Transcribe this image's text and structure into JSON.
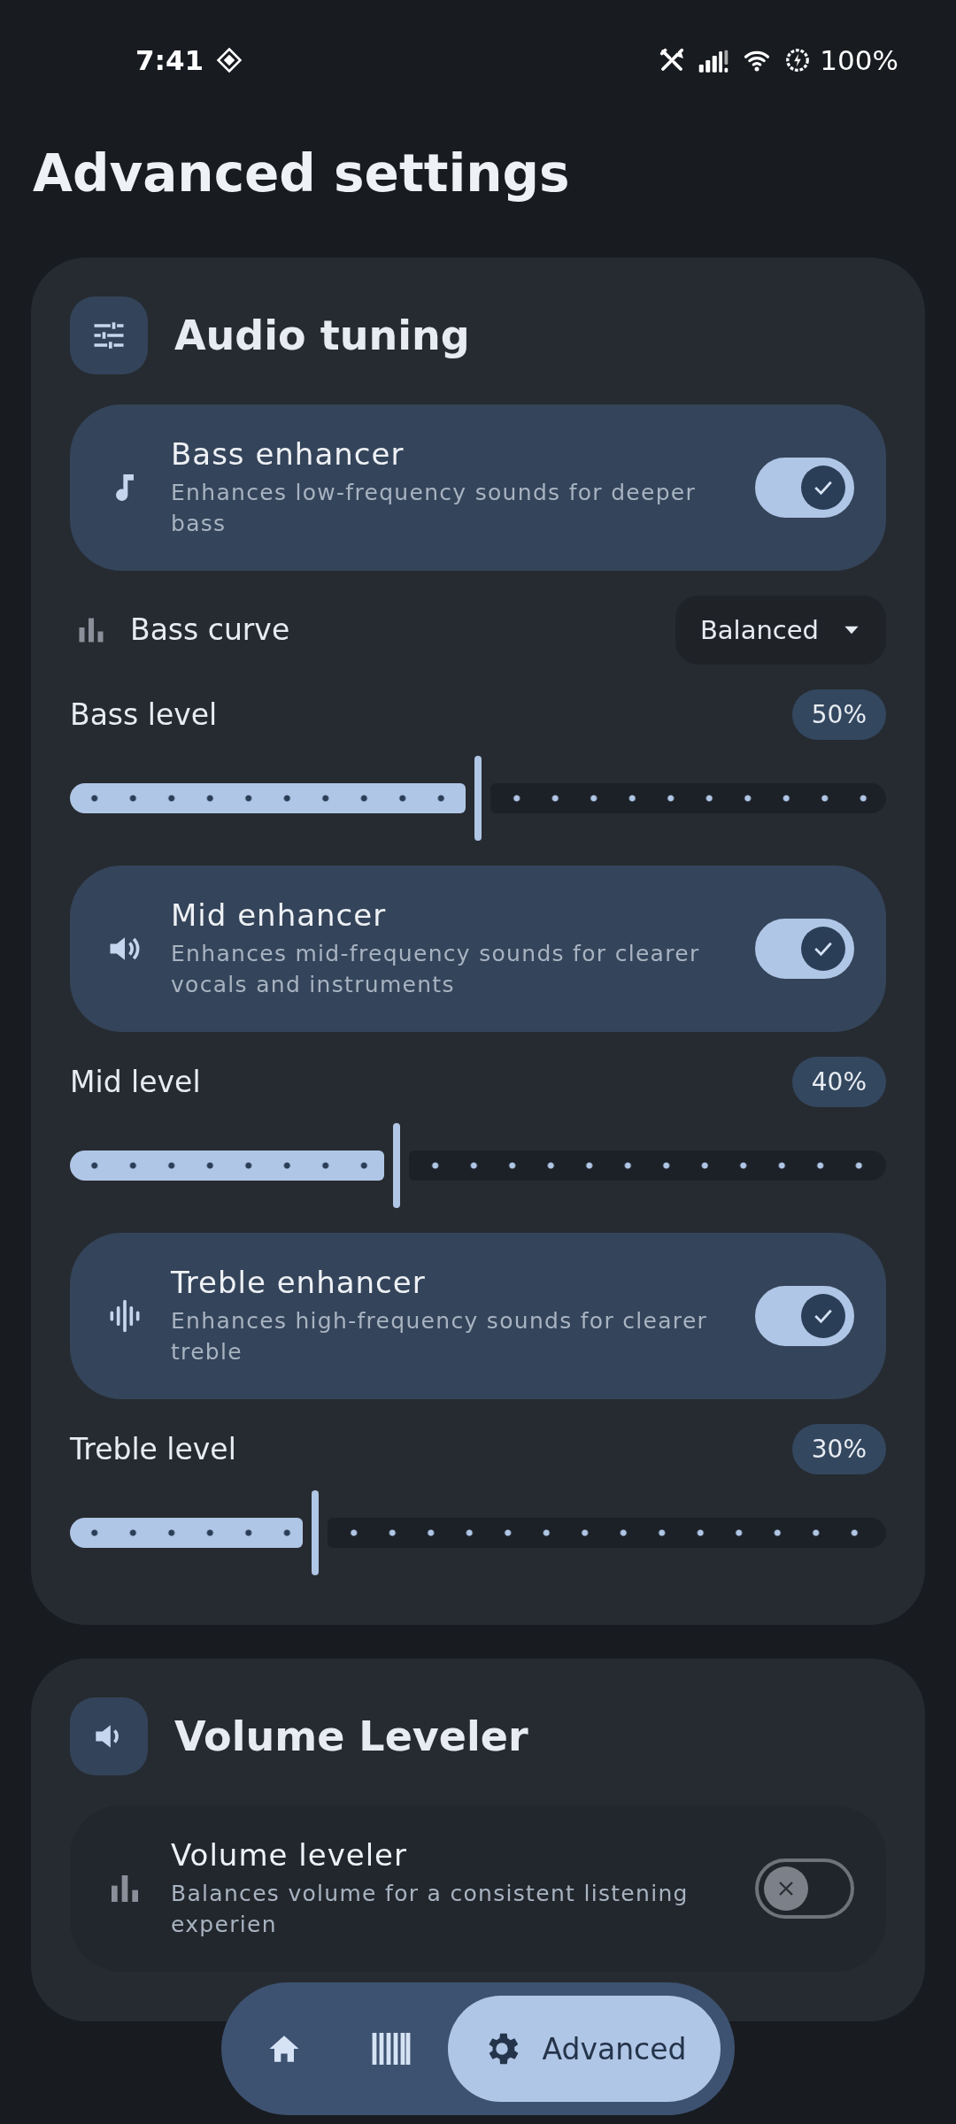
{
  "status_bar": {
    "time": "7:41",
    "battery": "100%"
  },
  "title": "Advanced settings",
  "sections": [
    {
      "title": "Audio tuning",
      "items": [
        {
          "kind": "toggle",
          "title": "Bass enhancer",
          "description": "Enhances low-frequency sounds for deeper bass",
          "on": true
        },
        {
          "kind": "dropdown",
          "label": "Bass curve",
          "value": "Balanced"
        },
        {
          "kind": "slider",
          "label": "Bass level",
          "reading": "50%",
          "level": 0.5
        },
        {
          "kind": "toggle",
          "title": "Mid enhancer",
          "description": "Enhances mid-frequency sounds for clearer vocals and instruments",
          "on": true
        },
        {
          "kind": "slider",
          "label": "Mid level",
          "reading": "40%",
          "level": 0.4
        },
        {
          "kind": "toggle",
          "title": "Treble enhancer",
          "description": "Enhances high-frequency sounds for clearer treble",
          "on": true
        },
        {
          "kind": "slider",
          "label": "Treble level",
          "reading": "30%",
          "level": 0.3
        }
      ]
    },
    {
      "title": "Volume Leveler",
      "items": [
        {
          "kind": "toggle",
          "title": "Volume leveler",
          "description": "Balances volume for a consistent listening experien",
          "on": false
        }
      ]
    }
  ],
  "nav": {
    "items": [
      {
        "selected": false
      },
      {
        "selected": false
      },
      {
        "label": "Advanced",
        "selected": true
      }
    ]
  }
}
